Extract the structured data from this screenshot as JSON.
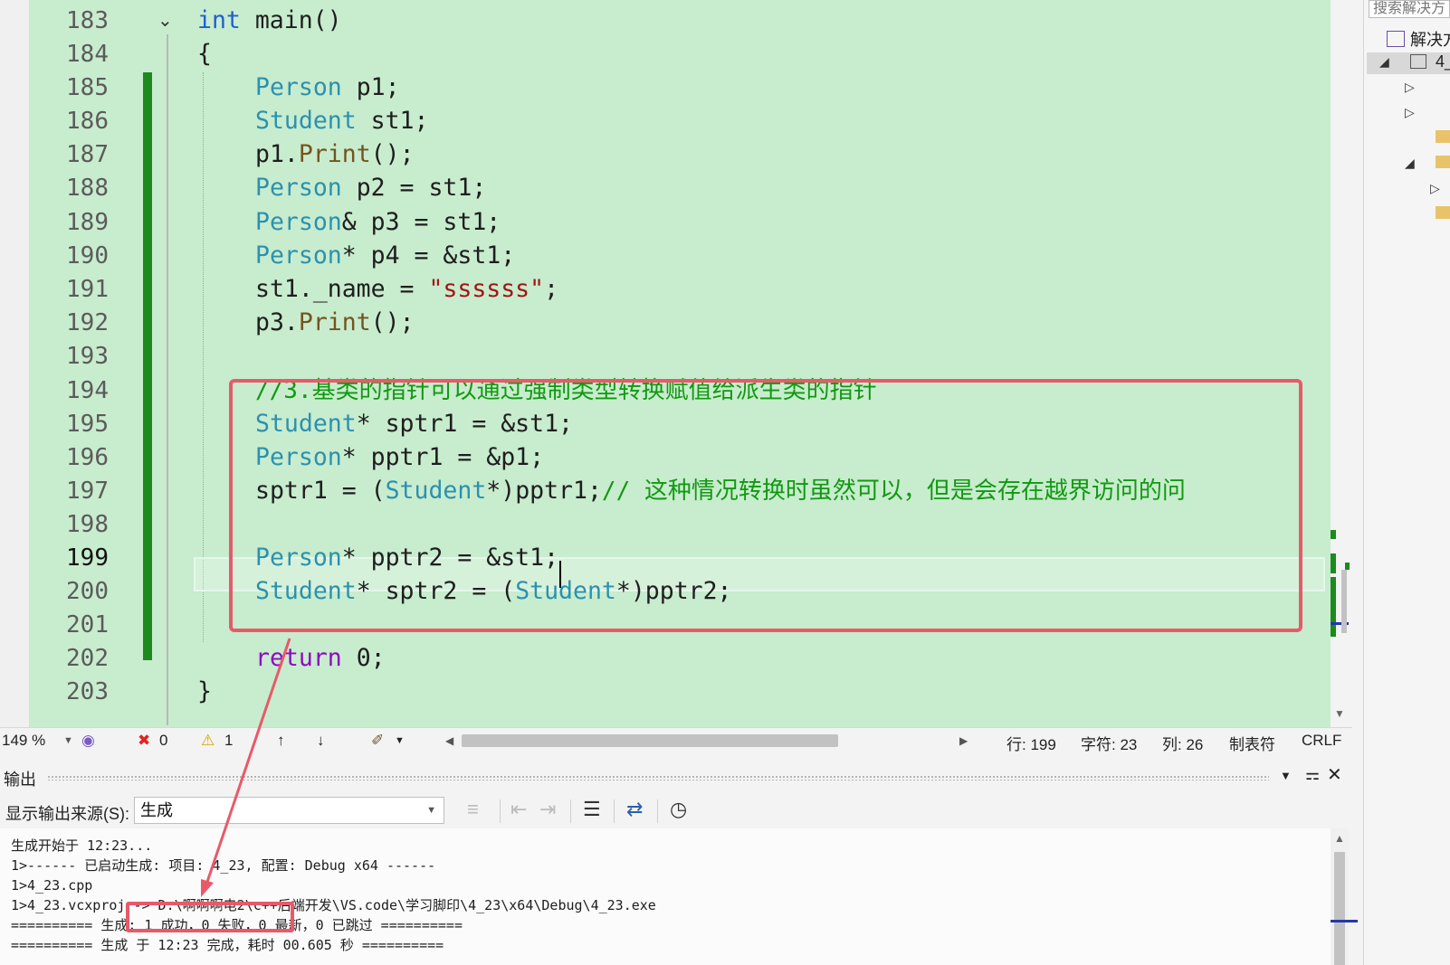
{
  "editor": {
    "lines": [
      {
        "num": "183",
        "text": ""
      },
      {
        "num": "184",
        "text": "{"
      },
      {
        "num": "185",
        "type": "Person",
        "rest": " p1;"
      },
      {
        "num": "186",
        "type": "Student",
        "rest": " st1;"
      },
      {
        "num": "187",
        "a": "p1.",
        "fn": "Print",
        "b": "();"
      },
      {
        "num": "188",
        "type": "Person",
        "rest": " p2 = st1;"
      },
      {
        "num": "189",
        "type": "Person",
        "rest": "& p3 = st1;"
      },
      {
        "num": "190",
        "type": "Person",
        "rest": "* p4 = &st1;"
      },
      {
        "num": "191",
        "a": "st1._name = ",
        "str": "\"ssssss\"",
        "b": ";"
      },
      {
        "num": "192",
        "a": "p3.",
        "fn": "Print",
        "b": "();"
      },
      {
        "num": "193",
        "text": ""
      },
      {
        "num": "194",
        "comment": "//3.基类的指针可以通过强制类型转换赋值给派生类的指针"
      },
      {
        "num": "195",
        "type": "Student",
        "rest": "* sptr1 = &st1;"
      },
      {
        "num": "196",
        "type": "Person",
        "rest": "* pptr1 = &p1;"
      },
      {
        "num": "197",
        "a": "sptr1 = (",
        "type": "Student",
        "b": "*)pptr1;",
        "comment": "// 这种情况转换时虽然可以，但是会存在越界访问的问"
      },
      {
        "num": "198",
        "text": ""
      },
      {
        "num": "199",
        "type": "Person",
        "rest": "* pptr2 = &st1;"
      },
      {
        "num": "200",
        "type": "Student",
        "rest": "* sptr2 = (",
        "type2": "Student",
        "b": "*)pptr2;"
      },
      {
        "num": "201",
        "text": ""
      },
      {
        "num": "202",
        "ret": "return",
        "rest": " 0;"
      },
      {
        "num": "203",
        "text": "}"
      }
    ],
    "line183": {
      "kw": "int",
      "rest": " main()"
    }
  },
  "status": {
    "zoom": "149 %",
    "errors": "0",
    "warnings": "1",
    "line": "行: 199",
    "char": "字符: 23",
    "col": "列: 26",
    "tabs": "制表符",
    "eol": "CRLF"
  },
  "output": {
    "title": "输出",
    "source_label": "显示输出来源(S):",
    "source_value": "生成",
    "lines": [
      "生成开始于 12:23...",
      "1>------ 已启动生成: 项目: 4_23, 配置: Debug x64 ------",
      "1>4_23.cpp",
      "1>4_23.vcxproj -> D:\\啊啊啊电2\\c++后端开发\\VS.code\\学习脚印\\4_23\\x64\\Debug\\4_23.exe",
      "========== 生成: 1 成功，0 失败，0 最新，0 已跳过 ==========",
      "========== 生成 于 12:23 完成，耗时 00.605 秒 =========="
    ]
  },
  "solution": {
    "search_placeholder": "搜索解决方",
    "row1": "解决方",
    "row2": "4_"
  },
  "colors": {
    "editor_bg": "#c8ecce",
    "highlight": "#e85a6a",
    "change_bar": "#1e8a1e"
  },
  "icons": [
    "error-icon",
    "warning-icon",
    "arrow-up-icon",
    "arrow-down-icon",
    "brush-icon",
    "clock-icon",
    "close-icon",
    "pin-icon"
  ]
}
